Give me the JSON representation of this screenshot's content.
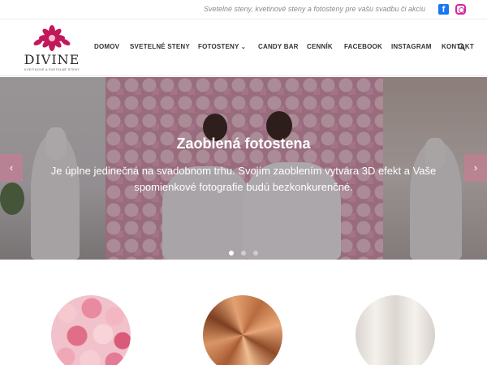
{
  "topbar": {
    "tagline": "Svetelné steny, kvetinové steny a fotosteny pre vašu svadbu či akciu",
    "social_icons": [
      "facebook-icon",
      "instagram-icon"
    ]
  },
  "logo": {
    "name": "DIVINE",
    "subtitle": "KVETINOVÉ A SVETELNÉ STENY",
    "accent_color": "#c2185b"
  },
  "nav": {
    "items": [
      {
        "label": "DOMOV"
      },
      {
        "label": "SVETELNÉ STENY"
      },
      {
        "label": "FOTOSTENY",
        "chevron": "⌄"
      },
      {
        "label": "CANDY BAR"
      },
      {
        "label": "CENNÍK"
      },
      {
        "label": "FACEBOOK"
      },
      {
        "label": "INSTAGRAM"
      },
      {
        "label": "KONTAKT"
      }
    ],
    "search_icon": "search-icon"
  },
  "hero": {
    "title": "Zaoblená fotostena",
    "text": "Je úplne jedinečná na svadobnom trhu. Svojím zaoblením vytvára 3D efekt a Vaše spomienkové fotografie budú bezkonkurenčné.",
    "prev_arrow": "‹",
    "next_arrow": "›",
    "slides_total": 3,
    "active_slide": 1,
    "arrow_color": "#d67896"
  },
  "features": {
    "images": [
      "rose-wall-image",
      "copper-3d-wall-image",
      "light-curtain-image"
    ]
  }
}
